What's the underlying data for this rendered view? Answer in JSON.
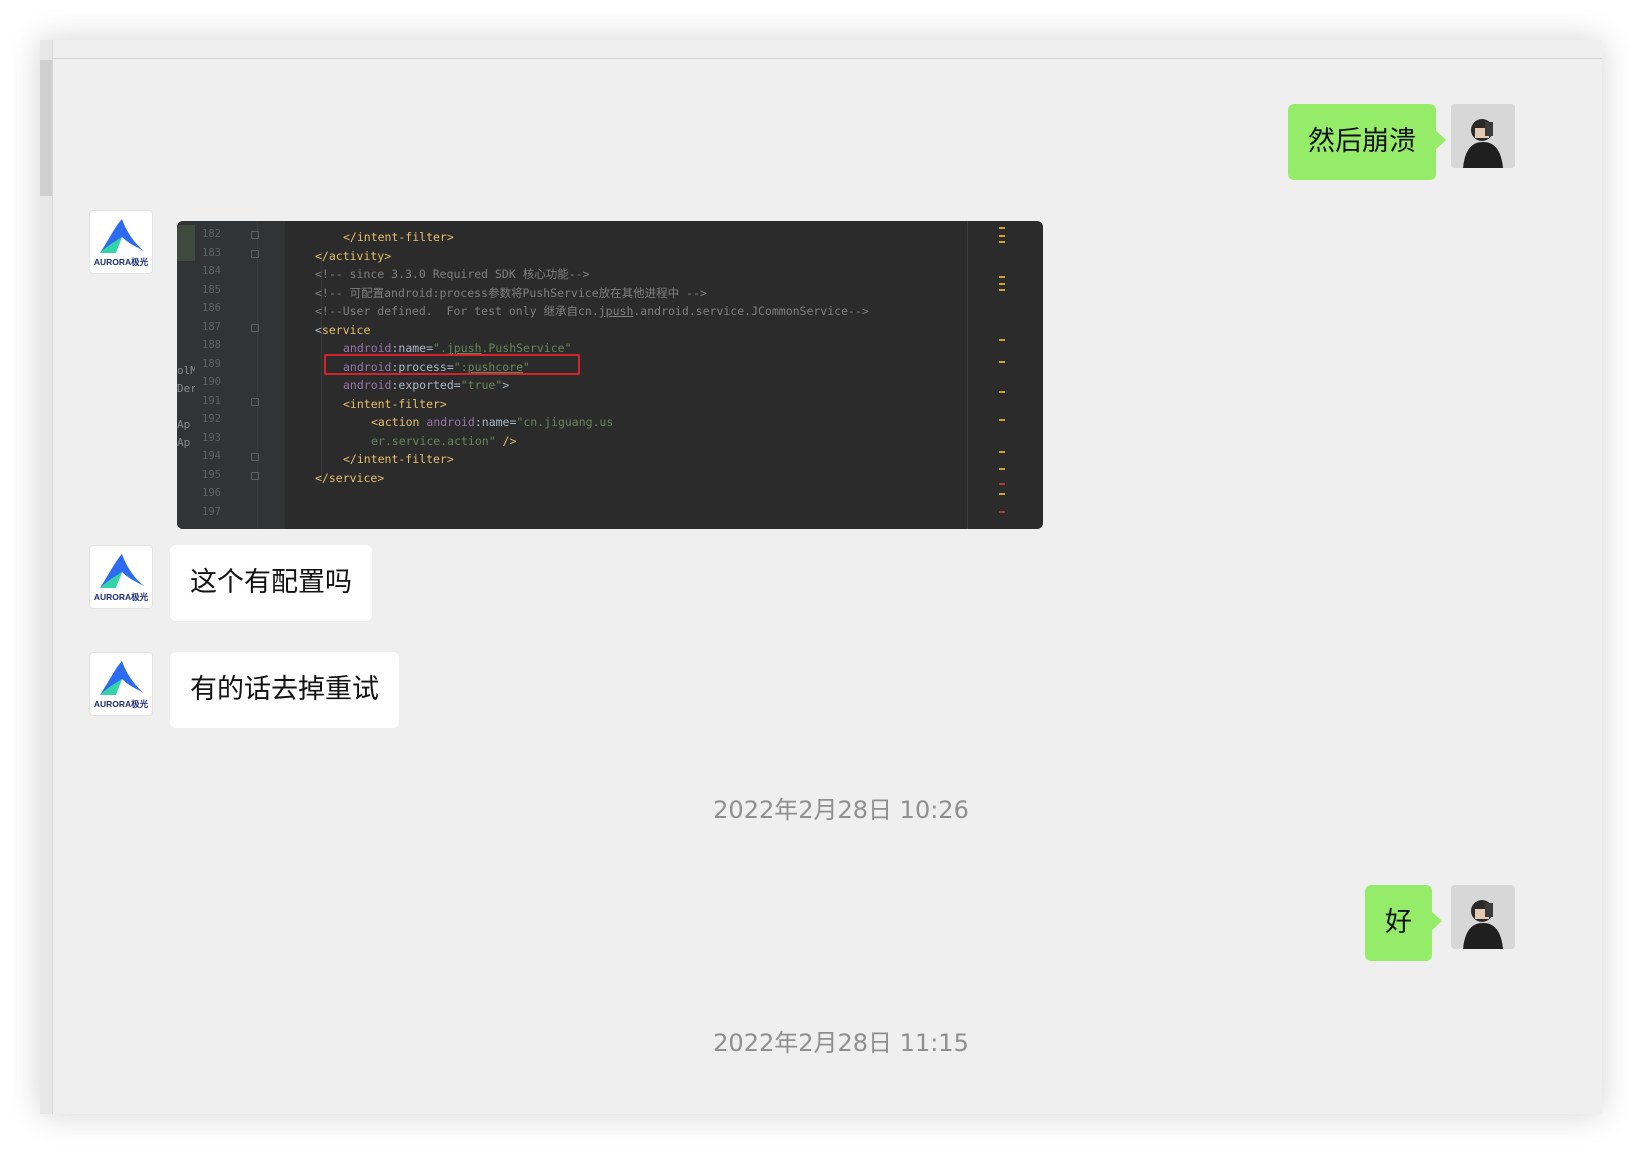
{
  "messages": {
    "m1": {
      "text": "然后崩溃"
    },
    "m3": {
      "text": "这个有配置吗"
    },
    "m4": {
      "text": "有的话去掉重试"
    },
    "m5": {
      "text": "好"
    }
  },
  "timestamps": [
    "2022年2月28日 10:26",
    "2022年2月28日 11:15"
  ],
  "aurora_logo": {
    "wordmark": "AURORA极光",
    "colors": [
      "#2d6bf2",
      "#33d4a6"
    ],
    "text_color": "#1f2d7a"
  },
  "colors": {
    "outgoing_bubble": "#95ec69",
    "incoming_bubble": "#ffffff",
    "chat_background": "#efefef",
    "highlight": "#d4232a"
  },
  "code_image": {
    "line_numbers": [
      "182",
      "183",
      "184",
      "185",
      "186",
      "187",
      "188",
      "189",
      "190",
      "191",
      "192",
      "193",
      "194",
      "195",
      "196",
      "197"
    ],
    "side_clip": [
      "olM",
      "Der",
      "Ap",
      "Ap"
    ],
    "lines": [
      [
        {
          "t": "</intent-filter>",
          "c": "tag"
        }
      ],
      [
        {
          "t": "</activity>",
          "c": "tag"
        }
      ],
      [
        {
          "t": "<!-- since 3.3.0 Required SDK 核心功能-->",
          "c": "comment"
        }
      ],
      [
        {
          "t": "<!-- 可配置android:process参数将PushService放在其他进程中 -->",
          "c": "comment"
        }
      ],
      [
        {
          "t": "<!--User defined.  For test only 继承自cn.",
          "c": "comment"
        },
        {
          "t": "jpush",
          "c": "comment under"
        },
        {
          "t": ".android.service.JCommonService-->",
          "c": "comment"
        }
      ],
      [
        {
          "t": "<",
          "c": "plain"
        },
        {
          "t": "service",
          "c": "tag"
        }
      ],
      [
        {
          "t": "android",
          "c": "attr"
        },
        {
          "t": ":name=",
          "c": "plain"
        },
        {
          "t": "\".",
          "c": "str"
        },
        {
          "t": "jpush",
          "c": "str under"
        },
        {
          "t": ".PushService\"",
          "c": "str"
        }
      ],
      [
        {
          "t": "android",
          "c": "attr"
        },
        {
          "t": ":process=",
          "c": "plain"
        },
        {
          "t": "\":",
          "c": "str"
        },
        {
          "t": "pushcore",
          "c": "str under"
        },
        {
          "t": "\"",
          "c": "str"
        }
      ],
      [
        {
          "t": "android",
          "c": "attr"
        },
        {
          "t": ":exported=",
          "c": "plain"
        },
        {
          "t": "\"true\"",
          "c": "str"
        },
        {
          "t": ">",
          "c": "plain"
        }
      ],
      [
        {
          "t": "<intent-filter>",
          "c": "tag"
        }
      ],
      [
        {
          "t": "<action ",
          "c": "tag"
        },
        {
          "t": "android",
          "c": "attr"
        },
        {
          "t": ":name=",
          "c": "plain"
        },
        {
          "t": "\"cn.jiguang.us",
          "c": "str"
        }
      ],
      [
        {
          "t": "er.service.action\"",
          "c": "str"
        },
        {
          "t": " />",
          "c": "tag"
        }
      ],
      [
        {
          "t": "</intent-filter>",
          "c": "tag"
        }
      ],
      [
        {
          "t": "</service>",
          "c": "tag"
        }
      ],
      [],
      []
    ]
  }
}
